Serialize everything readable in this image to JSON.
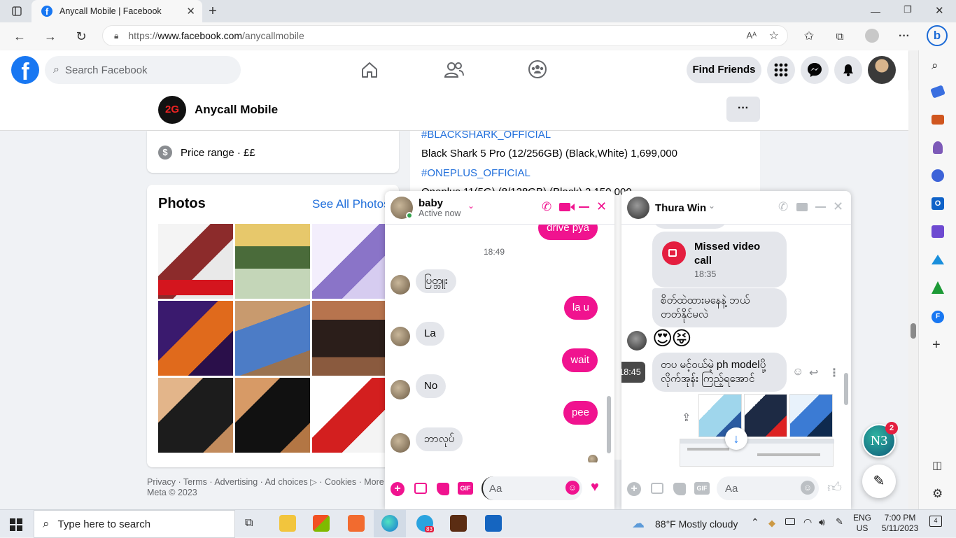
{
  "browser": {
    "tab_title": "Anycall Mobile | Facebook",
    "url_prefix": "https://",
    "url_domain": "www.facebook.com",
    "url_path": "/anycallmobile"
  },
  "fb": {
    "search_placeholder": "Search Facebook",
    "find_friends": "Find Friends"
  },
  "page": {
    "name": "Anycall Mobile",
    "more": "···"
  },
  "intro": {
    "price_range": "Price range · ££"
  },
  "photos": {
    "title": "Photos",
    "see_all": "See All Photos"
  },
  "post": {
    "lines": [
      "#BLACKSHARK_OFFICIAL",
      "Black Shark 5 Pro (12/256GB) (Black,White)  1,699,000",
      "#ONEPLUS_OFFICIAL",
      "Oneplus 11(5G) (8/128GB) (Black)  2,150,000"
    ]
  },
  "footer": {
    "links": [
      "Privacy",
      "Terms",
      "Advertising",
      "Ad choices",
      "Cookies",
      "More"
    ],
    "copyright": "Meta © 2023"
  },
  "chat1": {
    "name": "baby",
    "status": "Active now",
    "top_partial": "drive pya",
    "time": "18:49",
    "messages": [
      {
        "dir": "in",
        "text": "ပြတ္ဘူး"
      },
      {
        "dir": "out",
        "text": "la u"
      },
      {
        "dir": "in",
        "text": "La"
      },
      {
        "dir": "out",
        "text": "wait"
      },
      {
        "dir": "in",
        "text": "No"
      },
      {
        "dir": "out",
        "text": "pee"
      },
      {
        "dir": "in",
        "text": "ဘာလုပ်"
      }
    ],
    "input_placeholder": "Aa",
    "gif": "GIF"
  },
  "chat2": {
    "name": "Thura Win",
    "missed_title": "Missed video call",
    "missed_time": "18:35",
    "msg1": "စိတ်ထဲထားမနေနဲ့ ဘယ်တတ်နိုင်မလဲ",
    "emoji": "😍😝",
    "tooltip_time": "18:45",
    "msg2": "တပ မင့်ဝယ်မဲ့ ph modelပို့ လိုက်အုန်း ကြည့်ရအောင်",
    "input_placeholder": "Aa",
    "gif": "GIF"
  },
  "n3": {
    "label": "N3",
    "badge": "2"
  },
  "taskbar": {
    "search": "Type here to search",
    "weather": "88°F  Mostly cloudy",
    "lang1": "ENG",
    "lang2": "US",
    "time": "7:00 PM",
    "date": "5/11/2023",
    "notif": "4",
    "telegram_badge": "83"
  },
  "colors": {
    "fb_blue": "#1877f2",
    "messenger_pink": "#f0138f",
    "link": "#216fdb"
  }
}
